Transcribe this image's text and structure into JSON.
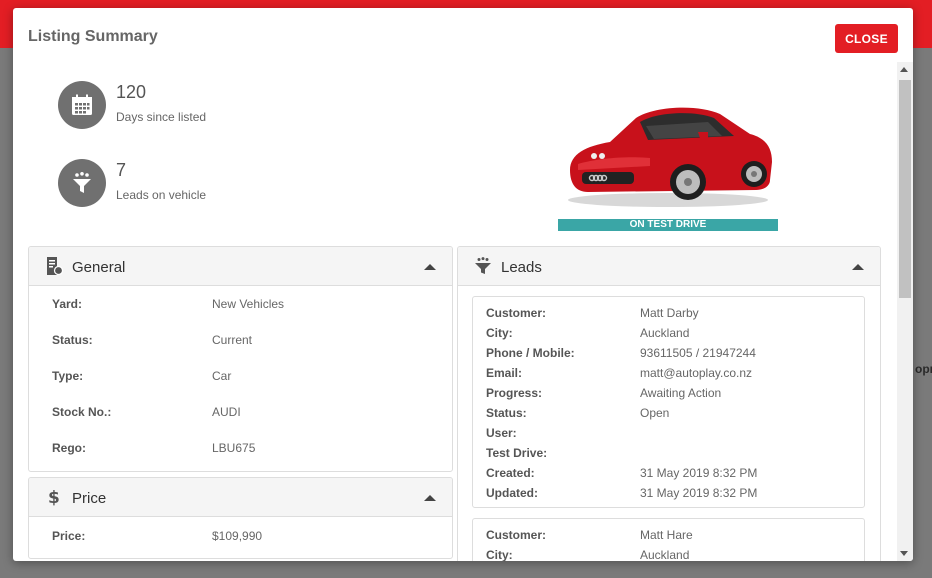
{
  "modal": {
    "title": "Listing Summary",
    "close_label": "CLOSE"
  },
  "stats": {
    "days": {
      "value": "120",
      "label": "Days since listed"
    },
    "leads": {
      "value": "7",
      "label": "Leads on vehicle"
    }
  },
  "vehicle": {
    "status_banner": "ON TEST DRIVE"
  },
  "general": {
    "title": "General",
    "rows": [
      {
        "key": "Yard:",
        "value": "New Vehicles"
      },
      {
        "key": "Status:",
        "value": "Current"
      },
      {
        "key": "Type:",
        "value": "Car"
      },
      {
        "key": "Stock No.:",
        "value": "AUDI"
      },
      {
        "key": "Rego:",
        "value": "LBU675"
      }
    ]
  },
  "price": {
    "title": "Price",
    "rows": [
      {
        "key": "Price:",
        "value": "$109,990"
      }
    ]
  },
  "leads": {
    "title": "Leads",
    "cards": [
      {
        "rows": [
          {
            "key": "Customer:",
            "value": "Matt Darby"
          },
          {
            "key": "City:",
            "value": "Auckland"
          },
          {
            "key": "Phone / Mobile:",
            "value": "93611505 / 21947244"
          },
          {
            "key": "Email:",
            "value": "matt@autoplay.co.nz"
          },
          {
            "key": "Progress:",
            "value": "Awaiting Action"
          },
          {
            "key": "Status:",
            "value": "Open"
          },
          {
            "key": "User:",
            "value": ""
          },
          {
            "key": "Test Drive:",
            "value": ""
          },
          {
            "key": "Created:",
            "value": "31 May 2019 8:32 PM"
          },
          {
            "key": "Updated:",
            "value": "31 May 2019 8:32 PM"
          }
        ]
      },
      {
        "rows": [
          {
            "key": "Customer:",
            "value": "Matt Hare"
          },
          {
            "key": "City:",
            "value": "Auckland"
          }
        ]
      }
    ]
  },
  "background": {
    "fragment_right": "opra"
  },
  "colors": {
    "brand_red": "#e31e24",
    "teal": "#3aa6a6",
    "icon_gray": "#707070"
  }
}
